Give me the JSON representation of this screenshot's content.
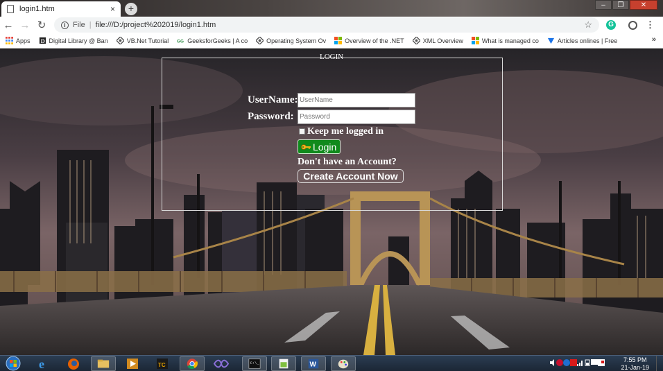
{
  "browser": {
    "tab_title": "login1.htm",
    "tab_close": "×",
    "new_tab": "+",
    "url_scheme": "File",
    "url": "file:///D:/project%202019/login1.htm",
    "window_controls": [
      "–",
      "❐",
      "✕"
    ]
  },
  "bookmarks": [
    {
      "label": "Apps",
      "icon": "apps-grid-icon",
      "color": "#e8453c"
    },
    {
      "label": "Digital Library @ Ban",
      "icon": "digital-library-icon",
      "color": "#333333"
    },
    {
      "label": "VB.Net Tutorial",
      "icon": "tutorial-icon",
      "color": "#555555"
    },
    {
      "label": "GeeksforGeeks | A co",
      "icon": "geeksforgeeks-icon",
      "color": "#2f8d46"
    },
    {
      "label": "Operating System Ov",
      "icon": "tutorial-icon",
      "color": "#555555"
    },
    {
      "label": "Overview of the .NET",
      "icon": "microsoft-icon",
      "color": "#f25022"
    },
    {
      "label": "XML Overview",
      "icon": "tutorial-icon",
      "color": "#555555"
    },
    {
      "label": "What is managed co",
      "icon": "microsoft-icon",
      "color": "#f25022"
    },
    {
      "label": "Articles onlines | Free",
      "icon": "articles-icon",
      "color": "#1a73e8"
    }
  ],
  "bookmarks_more": "»",
  "login": {
    "legend": "LOGIN",
    "username_label": "UserName:",
    "username_placeholder": "UserName",
    "password_label": "Password:",
    "password_placeholder": "Password",
    "keep_logged_in": "Keep me logged in",
    "login_button": "Login",
    "no_account_text": "Don't have an Account?",
    "create_account_button": "Create Account Now"
  },
  "taskbar": {
    "apps": [
      "start",
      "internet-explorer",
      "firefox",
      "file-explorer",
      "media-player",
      "turbo-c",
      "chrome",
      "visual-studio",
      "command-prompt",
      "notepad-plus",
      "word",
      "paint"
    ],
    "time": "7:55 PM",
    "date": "21-Jan-19"
  },
  "colors": {
    "login_button": "#108a1c",
    "chrome_green": "#15c39a"
  }
}
